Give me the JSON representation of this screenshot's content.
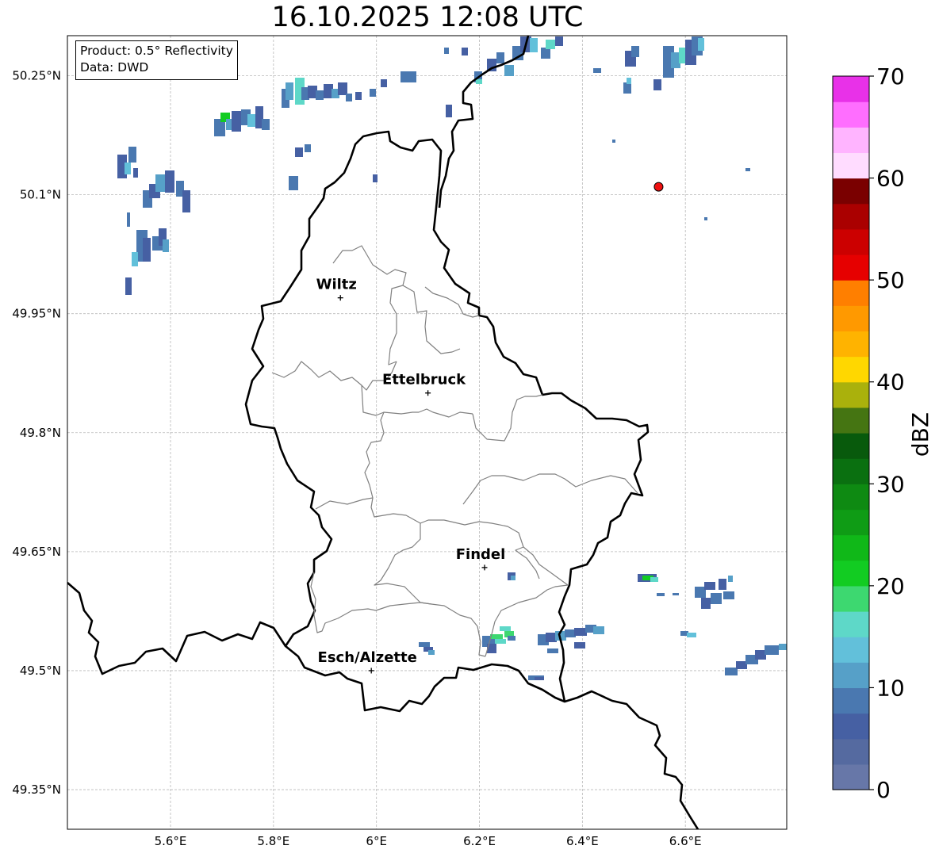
{
  "title": "16.10.2025 12:08 UTC",
  "info": {
    "product": "Product: 0.5° Reflectivity",
    "data": "Data: DWD"
  },
  "map": {
    "lon_range": [
      5.4,
      6.8
    ],
    "lat_range": [
      49.3,
      50.3
    ],
    "lon_ticks": [
      {
        "v": 5.6,
        "label": "5.6°E"
      },
      {
        "v": 5.8,
        "label": "5.8°E"
      },
      {
        "v": 6.0,
        "label": "6°E"
      },
      {
        "v": 6.2,
        "label": "6.2°E"
      },
      {
        "v": 6.4,
        "label": "6.4°E"
      },
      {
        "v": 6.6,
        "label": "6.6°E"
      }
    ],
    "lat_ticks": [
      {
        "v": 50.25,
        "label": "50.25°N"
      },
      {
        "v": 50.1,
        "label": "50.1°N"
      },
      {
        "v": 49.95,
        "label": "49.95°N"
      },
      {
        "v": 49.8,
        "label": "49.8°N"
      },
      {
        "v": 49.65,
        "label": "49.65°N"
      },
      {
        "v": 49.5,
        "label": "49.5°N"
      },
      {
        "v": 49.35,
        "label": "49.35°N"
      }
    ],
    "cities": [
      {
        "name": "Wiltz",
        "lon": 5.93,
        "lat": 49.97
      },
      {
        "name": "Ettelbruck",
        "lon": 6.1,
        "lat": 49.85
      },
      {
        "name": "Findel",
        "lon": 6.21,
        "lat": 49.63
      },
      {
        "name": "Esch/Alzette",
        "lon": 5.99,
        "lat": 49.5
      }
    ],
    "radar_site": {
      "lon": 6.548,
      "lat": 50.11,
      "color": "#ee1111"
    }
  },
  "colorbar": {
    "label": "dBZ",
    "min": 0,
    "max": 70,
    "tick_labels": [
      "0",
      "10",
      "20",
      "30",
      "40",
      "50",
      "60",
      "70"
    ],
    "colors": [
      "#6777a8",
      "#556aa0",
      "#4660a3",
      "#4a78b0",
      "#56a0c8",
      "#62c0da",
      "#5ed8c8",
      "#3dd870",
      "#12cc22",
      "#10b818",
      "#0f9c15",
      "#0e8a12",
      "#0a7010",
      "#085a0c",
      "#457512",
      "#aab10c",
      "#ffd700",
      "#ffb300",
      "#ff9900",
      "#ff7f00",
      "#e60000",
      "#cc0000",
      "#aa0000",
      "#7a0000",
      "#ffdcff",
      "#ffb4ff",
      "#ff6eff",
      "#e831e8"
    ]
  }
}
